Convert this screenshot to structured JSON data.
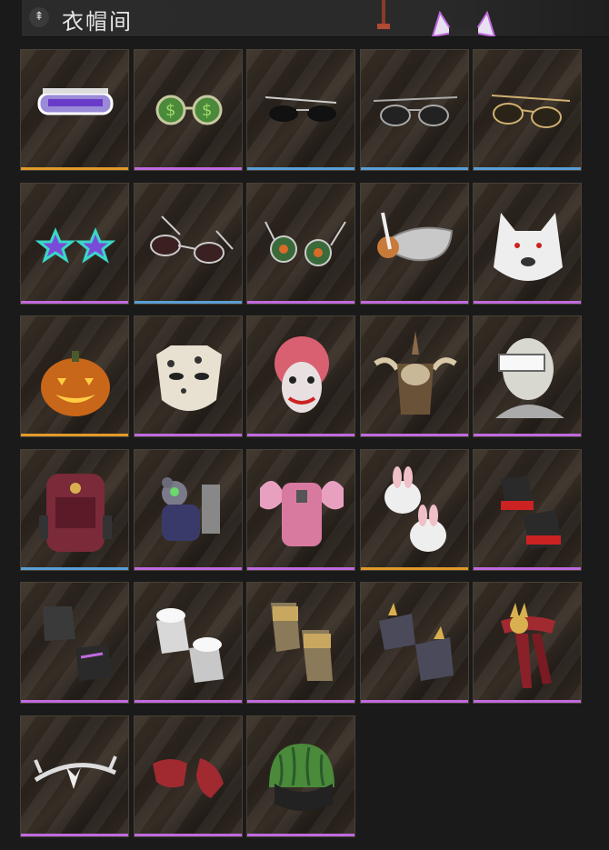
{
  "header": {
    "title": "衣帽间",
    "icon": "hanger-icon"
  },
  "rarity_colors": {
    "legendary": "#e09a2a",
    "epic": "#c06adf",
    "rare": "#5a9fd6"
  },
  "items": [
    {
      "icon": "visor-goggles-icon",
      "rarity": "legendary"
    },
    {
      "icon": "dollar-glasses-icon",
      "rarity": "epic"
    },
    {
      "icon": "black-sunglasses-icon",
      "rarity": "rare"
    },
    {
      "icon": "aviator-sunglasses-icon",
      "rarity": "rare"
    },
    {
      "icon": "gold-aviator-glasses-icon",
      "rarity": "rare"
    },
    {
      "icon": "star-glasses-icon",
      "rarity": "epic"
    },
    {
      "icon": "silver-aviator-glasses-icon",
      "rarity": "rare"
    },
    {
      "icon": "round-star-glasses-icon",
      "rarity": "epic"
    },
    {
      "icon": "feather-masquerade-mask-icon",
      "rarity": "epic"
    },
    {
      "icon": "white-wolf-mask-icon",
      "rarity": "epic"
    },
    {
      "icon": "pumpkin-head-icon",
      "rarity": "legendary"
    },
    {
      "icon": "leopard-mask-icon",
      "rarity": "epic"
    },
    {
      "icon": "clown-mask-icon",
      "rarity": "epic"
    },
    {
      "icon": "horned-tribal-helmet-icon",
      "rarity": "epic"
    },
    {
      "icon": "bandaged-visor-head-icon",
      "rarity": "epic"
    },
    {
      "icon": "tactical-backpack-icon",
      "rarity": "rare"
    },
    {
      "icon": "robot-bear-backpack-icon",
      "rarity": "epic"
    },
    {
      "icon": "pink-wing-backpack-icon",
      "rarity": "epic"
    },
    {
      "icon": "bunny-gloves-icon",
      "rarity": "legendary"
    },
    {
      "icon": "red-black-gloves-icon",
      "rarity": "epic"
    },
    {
      "icon": "purple-black-gloves-icon",
      "rarity": "epic"
    },
    {
      "icon": "fur-cuff-gloves-icon",
      "rarity": "epic"
    },
    {
      "icon": "gold-gauntlets-icon",
      "rarity": "epic"
    },
    {
      "icon": "spiked-bracers-icon",
      "rarity": "epic"
    },
    {
      "icon": "dragon-sash-icon",
      "rarity": "epic"
    },
    {
      "icon": "silver-tiara-icon",
      "rarity": "epic"
    },
    {
      "icon": "red-gloves-icon",
      "rarity": "epic"
    },
    {
      "icon": "watermelon-helmet-icon",
      "rarity": "epic"
    }
  ]
}
